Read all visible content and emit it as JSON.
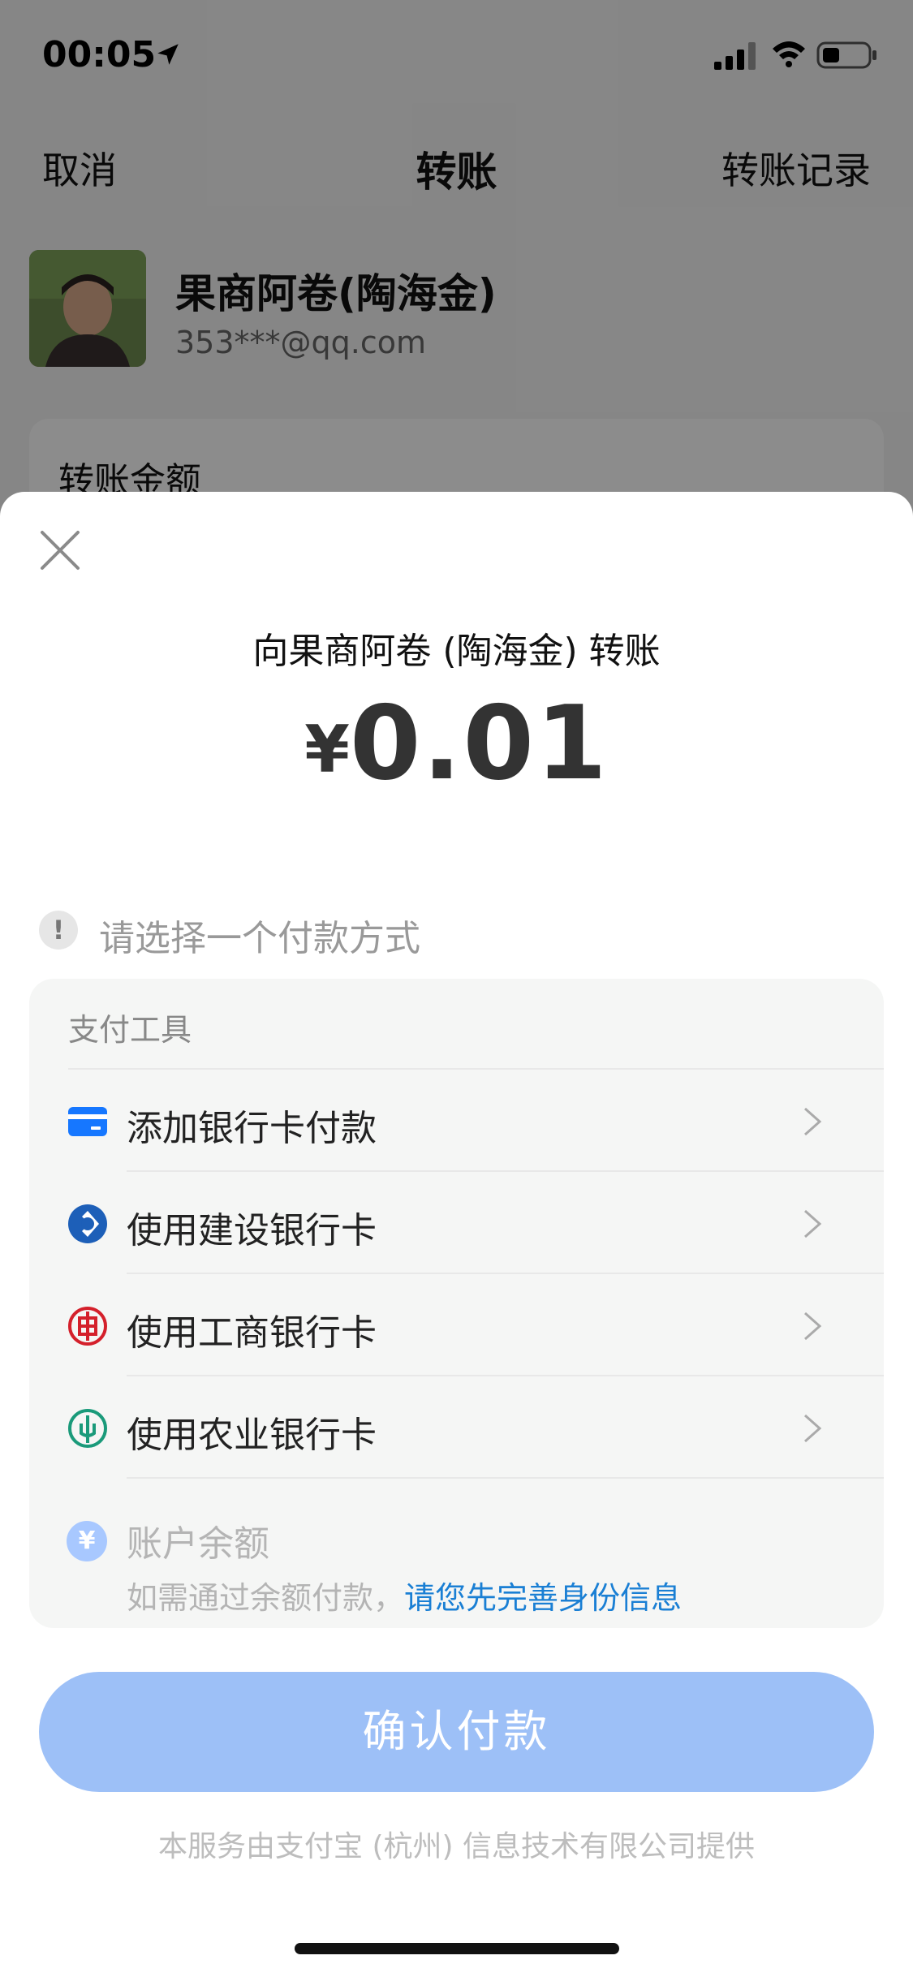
{
  "status_bar": {
    "time": "00:05"
  },
  "nav": {
    "cancel": "取消",
    "title": "转账",
    "records": "转账记录"
  },
  "payee": {
    "name": "果商阿卷(陶海金)",
    "account": "353***@qq.com"
  },
  "amount_card": {
    "label": "转账金额"
  },
  "sheet": {
    "title": "向果商阿卷 (陶海金) 转账",
    "currency": "¥",
    "amount": "0.01",
    "hint": "请选择一个付款方式",
    "card_header": "支付工具",
    "methods": [
      {
        "label": "添加银行卡付款",
        "icon": "bank-card-icon"
      },
      {
        "label": "使用建设银行卡",
        "icon": "ccb-logo-icon"
      },
      {
        "label": "使用工商银行卡",
        "icon": "icbc-logo-icon"
      },
      {
        "label": "使用农业银行卡",
        "icon": "abc-logo-icon"
      }
    ],
    "balance": {
      "label": "账户余额",
      "note": "如需通过余额付款，",
      "link": "请您先完善身份信息"
    },
    "confirm": "确认付款",
    "footer": "本服务由支付宝 (杭州) 信息技术有限公司提供"
  },
  "colors": {
    "accent": "#1a7fd4",
    "confirm_disabled": "#9dc0f7",
    "ccb": "#1d5fb8",
    "icbc": "#d4202b",
    "abc": "#1a9a7a"
  }
}
